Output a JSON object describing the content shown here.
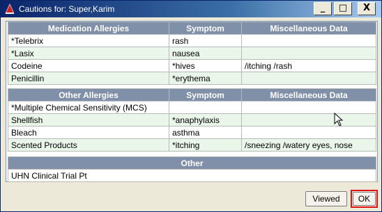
{
  "window": {
    "title": "Cautions for: Super,Karim",
    "minimize_glyph": "_",
    "maximize_glyph": "□",
    "close_glyph": "X"
  },
  "medication_allergies": {
    "headers": [
      "Medication Allergies",
      "Symptom",
      "Miscellaneous Data"
    ],
    "rows": [
      {
        "name": "*Telebrix",
        "symptom": "rash",
        "misc": ""
      },
      {
        "name": "*Lasix",
        "symptom": "nausea",
        "misc": ""
      },
      {
        "name": "Codeine",
        "symptom": "*hives",
        "misc": "/itching /rash"
      },
      {
        "name": "Penicillin",
        "symptom": "*erythema",
        "misc": ""
      }
    ]
  },
  "other_allergies": {
    "headers": [
      "Other Allergies",
      "Symptom",
      "Miscellaneous Data"
    ],
    "rows": [
      {
        "name": "*Multiple Chemical Sensitivity (MCS)",
        "symptom": "",
        "misc": ""
      },
      {
        "name": "Shellfish",
        "symptom": "*anaphylaxis",
        "misc": ""
      },
      {
        "name": "Bleach",
        "symptom": "asthma",
        "misc": ""
      },
      {
        "name": "Scented Products",
        "symptom": "*itching",
        "misc": "/sneezing /watery eyes, nose"
      }
    ]
  },
  "other": {
    "header": "Other",
    "rows": [
      "UHN Clinical Trial Pt"
    ]
  },
  "buttons": {
    "viewed": "Viewed",
    "ok": "OK"
  },
  "colors": {
    "header_bg": "#8090a8",
    "alt_row": "#eaf6ea",
    "ok_highlight": "#e01010"
  }
}
